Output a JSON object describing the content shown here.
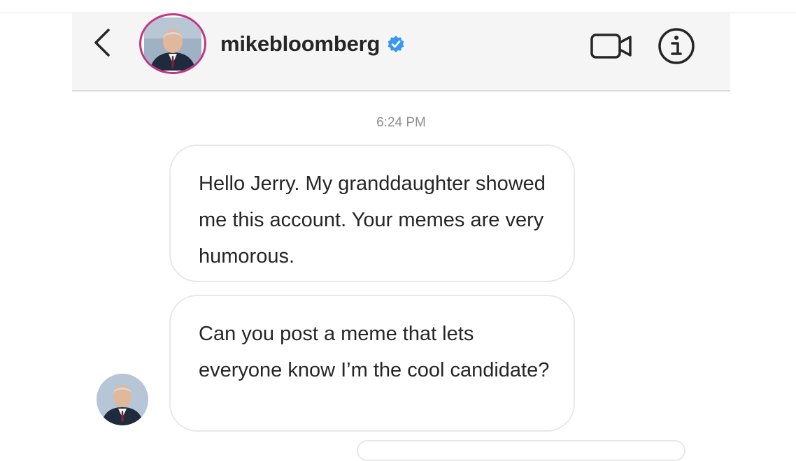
{
  "header": {
    "username": "mikebloomberg",
    "verified": true,
    "icons": {
      "back": "chevron-left-icon",
      "video": "video-camera-icon",
      "info": "info-icon",
      "verified": "verified-badge-icon"
    },
    "colors": {
      "background": "#f5f5f5",
      "verified_blue": "#3897f0",
      "avatar_ring": "#c13584"
    }
  },
  "conversation": {
    "timestamp": "6:24 PM",
    "messages": [
      {
        "text": "Hello Jerry. My granddaughter showed me this account. Your memes are very humorous."
      },
      {
        "text": "Can you post a meme that lets everyone know I’m the cool candidate?"
      }
    ]
  }
}
